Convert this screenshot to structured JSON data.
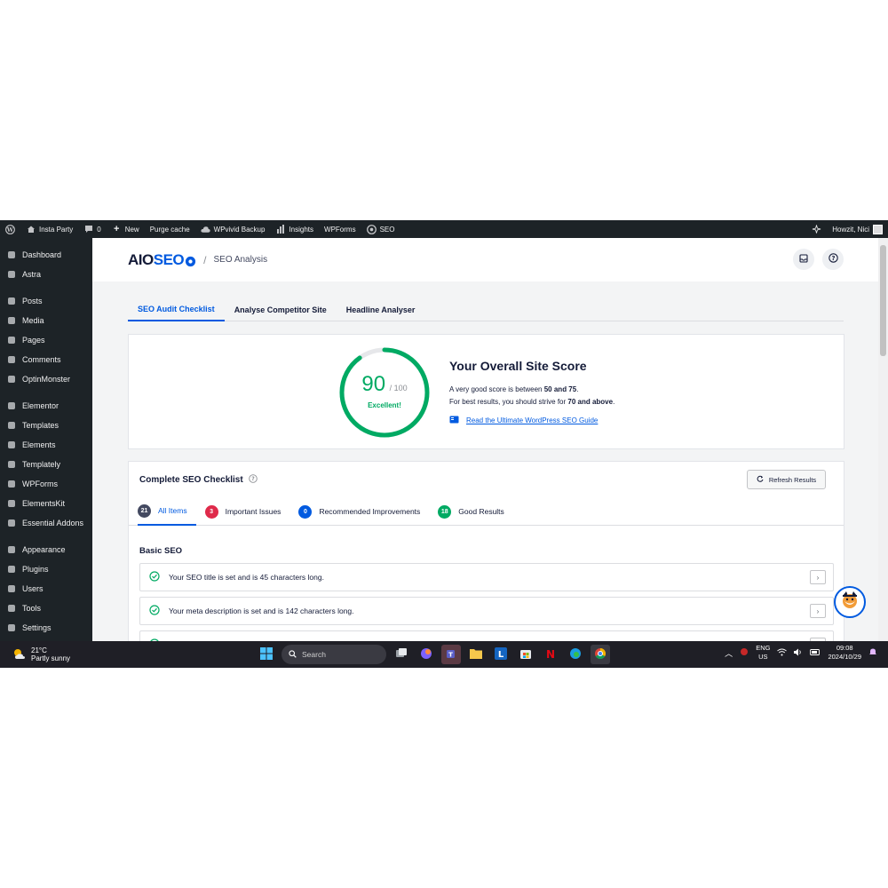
{
  "adminbar": {
    "site_name": "Insta Party",
    "comments_count": "0",
    "new_label": "New",
    "purge_label": "Purge cache",
    "wpvivid_label": "WPvivid Backup",
    "insights_label": "Insights",
    "wpforms_label": "WPForms",
    "seo_label": "SEO",
    "howdy_label": "Howzit, Nici"
  },
  "sidebar": {
    "items": [
      {
        "label": "Dashboard",
        "icon": "dashboard-icon"
      },
      {
        "label": "Astra",
        "icon": "astra-icon"
      },
      {
        "label": "Posts",
        "icon": "pin-icon"
      },
      {
        "label": "Media",
        "icon": "media-icon"
      },
      {
        "label": "Pages",
        "icon": "page-icon"
      },
      {
        "label": "Comments",
        "icon": "comment-icon"
      },
      {
        "label": "OptinMonster",
        "icon": "optinmonster-icon"
      },
      {
        "label": "Elementor",
        "icon": "elementor-icon"
      },
      {
        "label": "Templates",
        "icon": "folder-icon"
      },
      {
        "label": "Elements",
        "icon": "bolt-icon"
      },
      {
        "label": "Templately",
        "icon": "templately-icon"
      },
      {
        "label": "WPForms",
        "icon": "form-icon"
      },
      {
        "label": "ElementsKit",
        "icon": "elementskit-icon"
      },
      {
        "label": "Essential Addons",
        "icon": "ea-icon"
      },
      {
        "label": "Appearance",
        "icon": "brush-icon"
      },
      {
        "label": "Plugins",
        "icon": "plugin-icon"
      },
      {
        "label": "Users",
        "icon": "user-icon"
      },
      {
        "label": "Tools",
        "icon": "wrench-icon"
      },
      {
        "label": "Settings",
        "icon": "settings-icon"
      }
    ]
  },
  "header": {
    "logo_aio": "AIO",
    "logo_seo": "SEO",
    "breadcrumb_sep": "/",
    "breadcrumb": "SEO Analysis"
  },
  "tabs": [
    {
      "label": "SEO Audit Checklist",
      "active": true
    },
    {
      "label": "Analyse Competitor Site",
      "active": false
    },
    {
      "label": "Headline Analyser",
      "active": false
    }
  ],
  "score": {
    "value": "90",
    "out_of": "/ 100",
    "fraction": 0.9,
    "rating": "Excellent!",
    "title": "Your Overall Site Score",
    "desc_line1_pre": "A very good score is between ",
    "desc_line1_bold": "50 and 75",
    "desc_line1_post": ".",
    "desc_line2_pre": "For best results, you should strive for ",
    "desc_line2_bold": "70 and above",
    "desc_line2_post": ".",
    "guide_link": "Read the Ultimate WordPress SEO Guide",
    "color": "#00aa63"
  },
  "checklist": {
    "title": "Complete SEO Checklist",
    "refresh_label": "Refresh Results",
    "tabs": [
      {
        "count": "21",
        "label": "All Items",
        "color": "#434960"
      },
      {
        "count": "3",
        "label": "Important Issues",
        "color": "#df2a4a"
      },
      {
        "count": "0",
        "label": "Recommended Improvements",
        "color": "#005ae0"
      },
      {
        "count": "18",
        "label": "Good Results",
        "color": "#00aa63"
      }
    ],
    "section": "Basic SEO",
    "rows": [
      "Your SEO title is set and is 45 characters long.",
      "Your meta description is set and is 142 characters long."
    ]
  },
  "taskbar": {
    "temp": "21°C",
    "weather": "Partly sunny",
    "search": "Search",
    "lang1": "ENG",
    "lang2": "US",
    "time": "09:08",
    "date": "2024/10/29"
  }
}
